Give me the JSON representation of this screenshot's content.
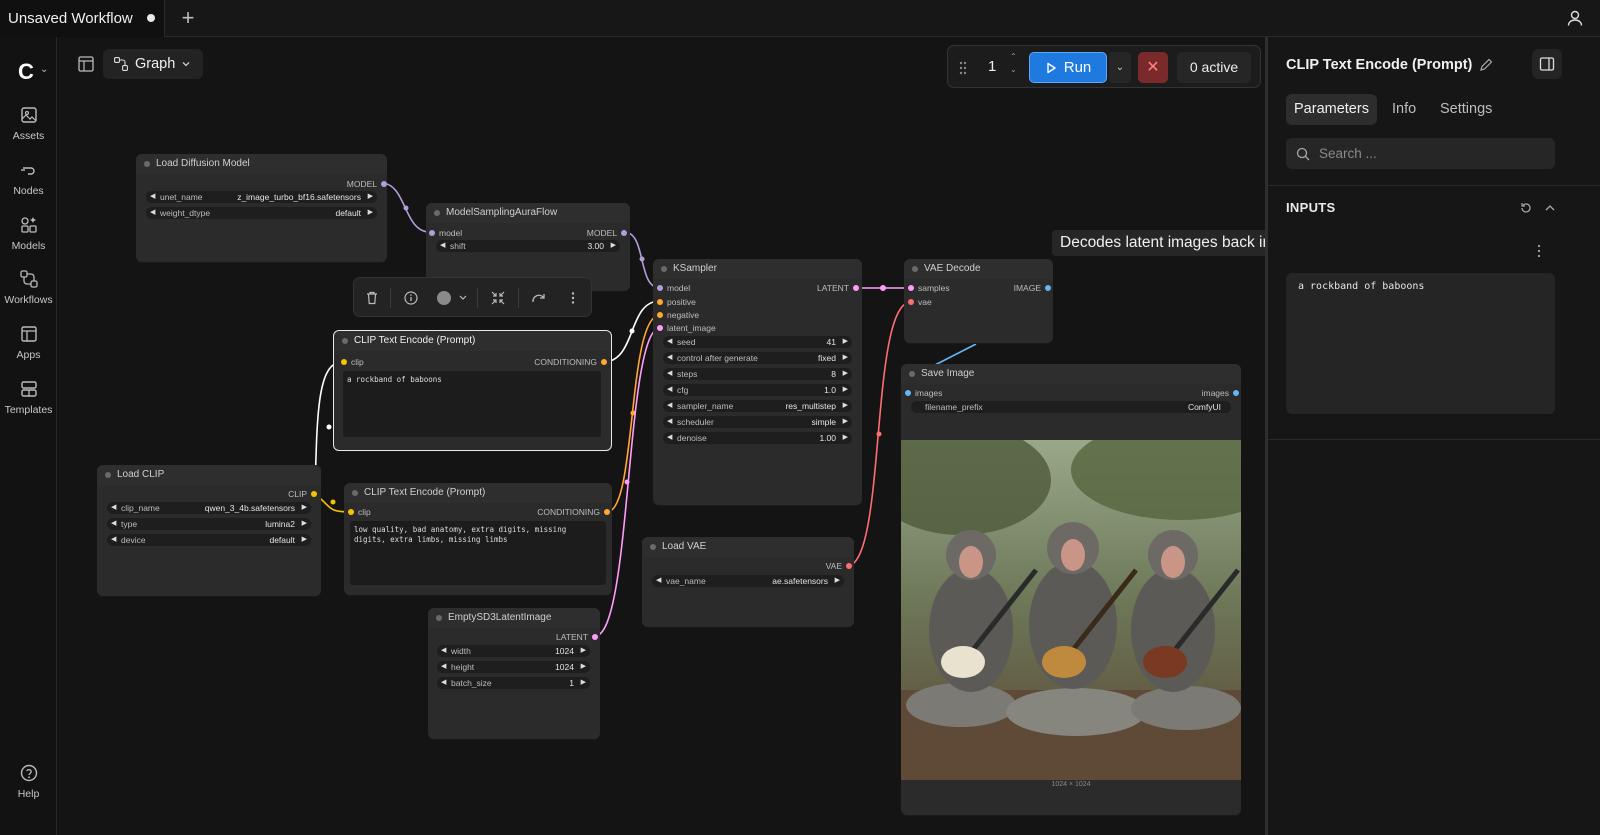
{
  "tabs": {
    "workflow_title": "Unsaved Workflow",
    "new_tab": "+"
  },
  "sidebar": {
    "items": [
      {
        "label": "Assets"
      },
      {
        "label": "Nodes"
      },
      {
        "label": "Models"
      },
      {
        "label": "Workflows"
      },
      {
        "label": "Apps"
      },
      {
        "label": "Templates"
      }
    ],
    "help": "Help"
  },
  "canvas_header": {
    "view_mode": "Graph"
  },
  "runbar": {
    "queue_count": "1",
    "run_label": "Run",
    "active_label": "0 active"
  },
  "tooltip": "Decodes latent images back into pixel space images.",
  "nodes": {
    "load_diffusion": {
      "title": "Load Diffusion Model",
      "out_model": "MODEL",
      "unet_name_label": "unet_name",
      "unet_name_value": "z_image_turbo_bf16.safetensors",
      "weight_dtype_label": "weight_dtype",
      "weight_dtype_value": "default"
    },
    "model_sampling": {
      "title": "ModelSamplingAuraFlow",
      "in_model": "model",
      "out_model": "MODEL",
      "shift_label": "shift",
      "shift_value": "3.00"
    },
    "clip_pos": {
      "title": "CLIP Text Encode (Prompt)",
      "in_clip": "clip",
      "out_cond": "CONDITIONING",
      "text": "a rockband of baboons"
    },
    "clip_neg": {
      "title": "CLIP Text Encode (Prompt)",
      "in_clip": "clip",
      "out_cond": "CONDITIONING",
      "text": "low quality, bad anatomy, extra digits, missing digits, extra limbs, missing limbs"
    },
    "load_clip": {
      "title": "Load CLIP",
      "out_clip": "CLIP",
      "clip_name_label": "clip_name",
      "clip_name_value": "qwen_3_4b.safetensors",
      "type_label": "type",
      "type_value": "lumina2",
      "device_label": "device",
      "device_value": "default"
    },
    "empty_latent": {
      "title": "EmptySD3LatentImage",
      "out_latent": "LATENT",
      "width_label": "width",
      "width_value": "1024",
      "height_label": "height",
      "height_value": "1024",
      "batch_label": "batch_size",
      "batch_value": "1"
    },
    "ksampler": {
      "title": "KSampler",
      "in_model": "model",
      "in_positive": "positive",
      "in_negative": "negative",
      "in_latent": "latent_image",
      "out_latent": "LATENT",
      "widgets": [
        {
          "label": "seed",
          "value": "41"
        },
        {
          "label": "control after generate",
          "value": "fixed"
        },
        {
          "label": "steps",
          "value": "8"
        },
        {
          "label": "cfg",
          "value": "1.0"
        },
        {
          "label": "sampler_name",
          "value": "res_multistep"
        },
        {
          "label": "scheduler",
          "value": "simple"
        },
        {
          "label": "denoise",
          "value": "1.00"
        }
      ]
    },
    "vae_decode": {
      "title": "VAE Decode",
      "in_samples": "samples",
      "in_vae": "vae",
      "out_image": "IMAGE"
    },
    "load_vae": {
      "title": "Load VAE",
      "out_vae": "VAE",
      "vae_name_label": "vae_name",
      "vae_name_value": "ae.safetensors"
    },
    "save_image": {
      "title": "Save Image",
      "in_images": "images",
      "out_images": "images",
      "prefix_label": "filename_prefix",
      "prefix_value": "ComfyUI",
      "image_size": "1024 × 1024"
    }
  },
  "right_panel": {
    "title": "CLIP Text Encode (Prompt)",
    "tabs": [
      "Parameters",
      "Info",
      "Settings"
    ],
    "search_placeholder": "Search ...",
    "section": "INPUTS",
    "text_value": "a rockband of baboons"
  },
  "colors": {
    "model_port": "#b39ddb",
    "clip_port": "#f5c400",
    "conditioning_port": "#ffa931",
    "latent_port": "#ff9cf9",
    "vae_port": "#ff6e6e",
    "image_port": "#64b5f6",
    "run_button": "#1f7ae0"
  }
}
